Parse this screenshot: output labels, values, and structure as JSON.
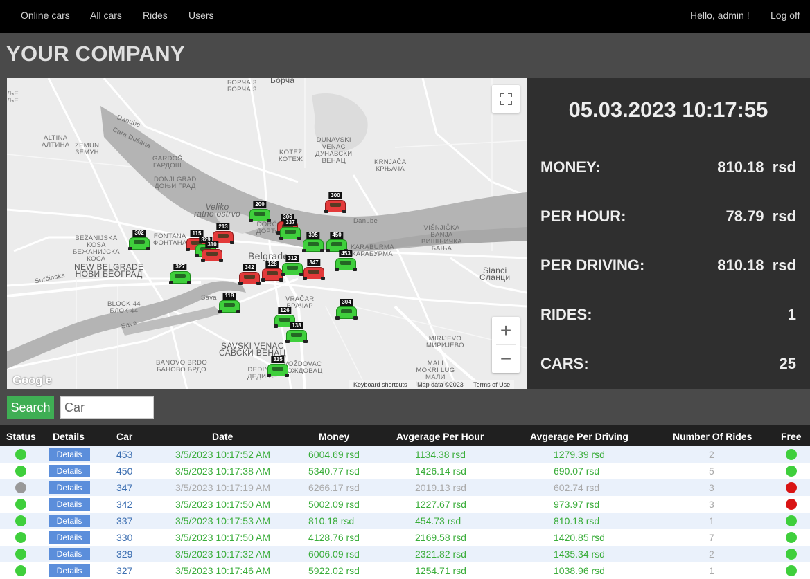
{
  "nav": {
    "items": [
      "Online cars",
      "All cars",
      "Rides",
      "Users"
    ],
    "hello": "Hello, admin !",
    "logoff": "Log off"
  },
  "company": "YOUR COMPANY",
  "map": {
    "labels": {
      "borca": "БОРЧА 3\nБОРЧА 3",
      "borca_big": "Борча",
      "danube1": "Danube",
      "danube2": "Danube",
      "cara": "Cara Dušana",
      "altina": "ALTINA\nАЛТИНА",
      "zemun": "ZEMUN\nЗЕМУН",
      "gardos": "GARDOŠ\nГАРДОШ",
      "donji": "DONJI GRAD\nДОЊИ ГРАД",
      "kotez": "KOTEŽ\nКОТЕЖ",
      "dunavski": "DUNAVSKI\nVENAC\nДУНАВСКИ\nВЕНАЦ",
      "krnjaca": "KRNJAČA\nКРЊАЧА",
      "veliko": "Veliko\nratno ostrvo",
      "bezanijska": "BEŽANIJSKA\nKOSA\nБЕЖАНИЈСКА\nКОСА",
      "fontana": "FONTANA\nФОНТАНА",
      "dorcol": "DORĆOL\nДОРЋОЛ",
      "visnjicka": "VIŠNJIČKA\nBANJA\nВИШЊИЧКА\nБАЊА",
      "karaburma": "KARABURMA\nКАРАБУРМА",
      "newbelgrade": "NEW BELGRADE\nНОВИ БЕОГРАД",
      "belgrade": "Belgrade",
      "slanci": "Slanci\nСланци",
      "surcinska": "Surčinska",
      "block44": "BLOCK 44\nБЛОК 44",
      "vracar": "VRAČAR\nВРАЧАР",
      "sava1": "Sava",
      "sava2": "Sava",
      "savski": "SAVSKI VENAC\nСАВСКИ ВЕНАЦ",
      "mirijevo": "MIRIJEVO\nМИРИЈЕВО",
      "banovo": "BANOVO BRDO\nБАНОВО БРДО",
      "vozdovac": "VOŽDOVAC\nВОЖДОВАЦ",
      "mali": "MALI\nMOKRI LUG\nМАЛИ\nМОКРИ ЛУГ",
      "ledje": "ЉЕ\nЉЕ",
      "dedinje": "DEDINJE\nДЕДИЊЕ"
    },
    "cars": [
      {
        "id": "200",
        "color": "green"
      },
      {
        "id": "300",
        "color": "red"
      },
      {
        "id": "306",
        "color": "red"
      },
      {
        "id": "337",
        "color": "green"
      },
      {
        "id": "302",
        "color": "green"
      },
      {
        "id": "213",
        "color": "red"
      },
      {
        "id": "115",
        "color": "red"
      },
      {
        "id": "329",
        "color": "green"
      },
      {
        "id": "310",
        "color": "red"
      },
      {
        "id": "305",
        "color": "green"
      },
      {
        "id": "450",
        "color": "green"
      },
      {
        "id": "453",
        "color": "green"
      },
      {
        "id": "327",
        "color": "green"
      },
      {
        "id": "342",
        "color": "red"
      },
      {
        "id": "128",
        "color": "red"
      },
      {
        "id": "312",
        "color": "green"
      },
      {
        "id": "347",
        "color": "red"
      },
      {
        "id": "118",
        "color": "green"
      },
      {
        "id": "304",
        "color": "green"
      },
      {
        "id": "126",
        "color": "green"
      },
      {
        "id": "138",
        "color": "green"
      },
      {
        "id": "315",
        "color": "green"
      }
    ],
    "google": "Google",
    "keyboard": "Keyboard shortcuts",
    "mapdata": "Map data ©2023",
    "terms": "Terms of Use",
    "zoom_in": "+",
    "zoom_out": "−"
  },
  "stats": {
    "datetime": "05.03.2023 10:17:55",
    "money_label": "MONEY:",
    "money_value": "810.18  rsd",
    "perhour_label": "PER HOUR:",
    "perhour_value": "78.79  rsd",
    "perdriving_label": "PER DRIVING:",
    "perdriving_value": "810.18  rsd",
    "rides_label": "RIDES:",
    "rides_value": "1",
    "cars_label": "CARS:",
    "cars_value": "25"
  },
  "search": {
    "button": "Search",
    "placeholder": "Car"
  },
  "table": {
    "headers": [
      "Status",
      "Details",
      "Car",
      "Date",
      "Money",
      "Avgerage Per Hour",
      "Avgerage Per Driving",
      "Number Of Rides",
      "Free"
    ],
    "details_label": "Details",
    "rows": [
      {
        "status": "online",
        "car": "453",
        "date": "3/5/2023 10:17:52 AM",
        "money": "6004.69 rsd",
        "per_hour": "1134.38 rsd",
        "per_driving": "1279.39 rsd",
        "rides": "2",
        "free": "yes"
      },
      {
        "status": "online",
        "car": "450",
        "date": "3/5/2023 10:17:38 AM",
        "money": "5340.77 rsd",
        "per_hour": "1426.14 rsd",
        "per_driving": "690.07 rsd",
        "rides": "5",
        "free": "yes"
      },
      {
        "status": "offline",
        "car": "347",
        "date": "3/5/2023 10:17:19 AM",
        "money": "6266.17 rsd",
        "per_hour": "2019.13 rsd",
        "per_driving": "602.74 rsd",
        "rides": "3",
        "free": "no"
      },
      {
        "status": "online",
        "car": "342",
        "date": "3/5/2023 10:17:50 AM",
        "money": "5002.09 rsd",
        "per_hour": "1227.67 rsd",
        "per_driving": "973.97 rsd",
        "rides": "3",
        "free": "no"
      },
      {
        "status": "online",
        "car": "337",
        "date": "3/5/2023 10:17:53 AM",
        "money": "810.18 rsd",
        "per_hour": "454.73 rsd",
        "per_driving": "810.18 rsd",
        "rides": "1",
        "free": "yes"
      },
      {
        "status": "online",
        "car": "330",
        "date": "3/5/2023 10:17:50 AM",
        "money": "4128.76 rsd",
        "per_hour": "2169.58 rsd",
        "per_driving": "1420.85 rsd",
        "rides": "7",
        "free": "yes"
      },
      {
        "status": "online",
        "car": "329",
        "date": "3/5/2023 10:17:32 AM",
        "money": "6006.09 rsd",
        "per_hour": "2321.82 rsd",
        "per_driving": "1435.34 rsd",
        "rides": "2",
        "free": "yes"
      },
      {
        "status": "online",
        "car": "327",
        "date": "3/5/2023 10:17:46 AM",
        "money": "5922.02 rsd",
        "per_hour": "1254.71 rsd",
        "per_driving": "1038.96 rsd",
        "rides": "1",
        "free": "yes"
      }
    ]
  },
  "colors": {
    "status_online": "#3fcf3c",
    "status_offline": "#999999",
    "free_yes": "#3fcf3c",
    "free_no": "#d91414",
    "search_button": "#3fae54",
    "details_button": "#5b8edb"
  }
}
